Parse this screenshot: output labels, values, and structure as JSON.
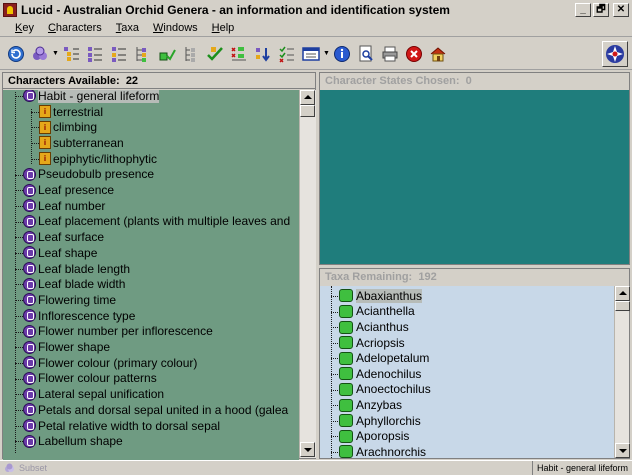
{
  "window": {
    "title": "Lucid - Australian Orchid Genera - an information and identification system",
    "controls": [
      "_",
      "🗗",
      "✕"
    ]
  },
  "menu": {
    "items": [
      {
        "label": "Key",
        "u": "K"
      },
      {
        "label": "Characters",
        "u": "C"
      },
      {
        "label": "Taxa",
        "u": "T"
      },
      {
        "label": "Windows",
        "u": "W"
      },
      {
        "label": "Help",
        "u": "H"
      }
    ]
  },
  "toolbar": {
    "icons": [
      "restart-icon",
      "options-icon",
      "select-characters-icon",
      "best-icon",
      "prune-icon",
      "differences-icon",
      "find-taxa-icon",
      "sort-icon",
      "check-icon",
      "list-icon",
      "view-icon",
      "info-icon",
      "preview-icon",
      "print-icon",
      "stop-icon",
      "home-icon",
      "lucid-logo-icon"
    ]
  },
  "characters": {
    "header": "Characters Available:",
    "count": "22",
    "items": [
      {
        "label": "Habit - general lifeform",
        "level": 0,
        "kind": "character",
        "selected": true
      },
      {
        "label": "terrestrial",
        "level": 1,
        "kind": "state"
      },
      {
        "label": "climbing",
        "level": 1,
        "kind": "state"
      },
      {
        "label": "subterranean",
        "level": 1,
        "kind": "state"
      },
      {
        "label": "epiphytic/lithophytic",
        "level": 1,
        "kind": "state"
      },
      {
        "label": "Pseudobulb presence",
        "level": 0,
        "kind": "character"
      },
      {
        "label": "Leaf presence",
        "level": 0,
        "kind": "character"
      },
      {
        "label": "Leaf number",
        "level": 0,
        "kind": "character"
      },
      {
        "label": "Leaf placement (plants with multiple leaves and",
        "level": 0,
        "kind": "character"
      },
      {
        "label": "Leaf surface",
        "level": 0,
        "kind": "character"
      },
      {
        "label": "Leaf shape",
        "level": 0,
        "kind": "character"
      },
      {
        "label": "Leaf blade length",
        "level": 0,
        "kind": "character"
      },
      {
        "label": "Leaf blade width",
        "level": 0,
        "kind": "character"
      },
      {
        "label": "Flowering time",
        "level": 0,
        "kind": "character"
      },
      {
        "label": "Inflorescence type",
        "level": 0,
        "kind": "character"
      },
      {
        "label": "Flower number per inflorescence",
        "level": 0,
        "kind": "character"
      },
      {
        "label": "Flower shape",
        "level": 0,
        "kind": "character"
      },
      {
        "label": "Flower colour (primary colour)",
        "level": 0,
        "kind": "character"
      },
      {
        "label": "Flower colour patterns",
        "level": 0,
        "kind": "character"
      },
      {
        "label": "Lateral sepal unification",
        "level": 0,
        "kind": "character"
      },
      {
        "label": "Petals and dorsal sepal united in a hood (galea",
        "level": 0,
        "kind": "character"
      },
      {
        "label": "Petal relative width to dorsal sepal",
        "level": 0,
        "kind": "character"
      },
      {
        "label": "Labellum shape",
        "level": 0,
        "kind": "character"
      }
    ]
  },
  "states_chosen": {
    "header": "Character States Chosen:",
    "count": "0"
  },
  "taxa": {
    "header": "Taxa Remaining:",
    "count": "192",
    "items": [
      "Abaxianthus",
      "Acianthella",
      "Acianthus",
      "Acriopsis",
      "Adelopetalum",
      "Adenochilus",
      "Anoectochilus",
      "Anzybas",
      "Aphyllorchis",
      "Aporopsis",
      "Arachnorchis"
    ]
  },
  "status": {
    "left": "Subset",
    "right": "Habit - general lifeform"
  }
}
